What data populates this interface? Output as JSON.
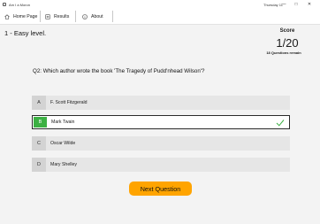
{
  "window": {
    "title": "Am I a Moron",
    "clock": "Thursday 11",
    "minimize": "—",
    "maximize": "□",
    "close": "✕"
  },
  "nav": {
    "items": [
      {
        "label": "Home Page",
        "icon": "home-icon"
      },
      {
        "label": "Results",
        "icon": "results-icon"
      },
      {
        "label": "About",
        "icon": "info-icon"
      }
    ]
  },
  "level": {
    "title": "1 - Easy level."
  },
  "score": {
    "label": "Score",
    "value": "1/20",
    "remaining": "18 Questions remain"
  },
  "question": {
    "text": "Q2: Which author wrote the book 'The Tragedy of Pudd'nhead Wilson'?"
  },
  "answers": [
    {
      "letter": "A",
      "text": "F. Scott Fitzgerald",
      "selected": false
    },
    {
      "letter": "B",
      "text": "Mark Twain",
      "selected": true,
      "correct": true
    },
    {
      "letter": "C",
      "text": "Oscar Wilde",
      "selected": false
    },
    {
      "letter": "D",
      "text": "Mary Shelley",
      "selected": false
    }
  ],
  "actions": {
    "next_label": "Next Question"
  },
  "colors": {
    "accent": "#ffa400",
    "correct": "#3cb043"
  }
}
